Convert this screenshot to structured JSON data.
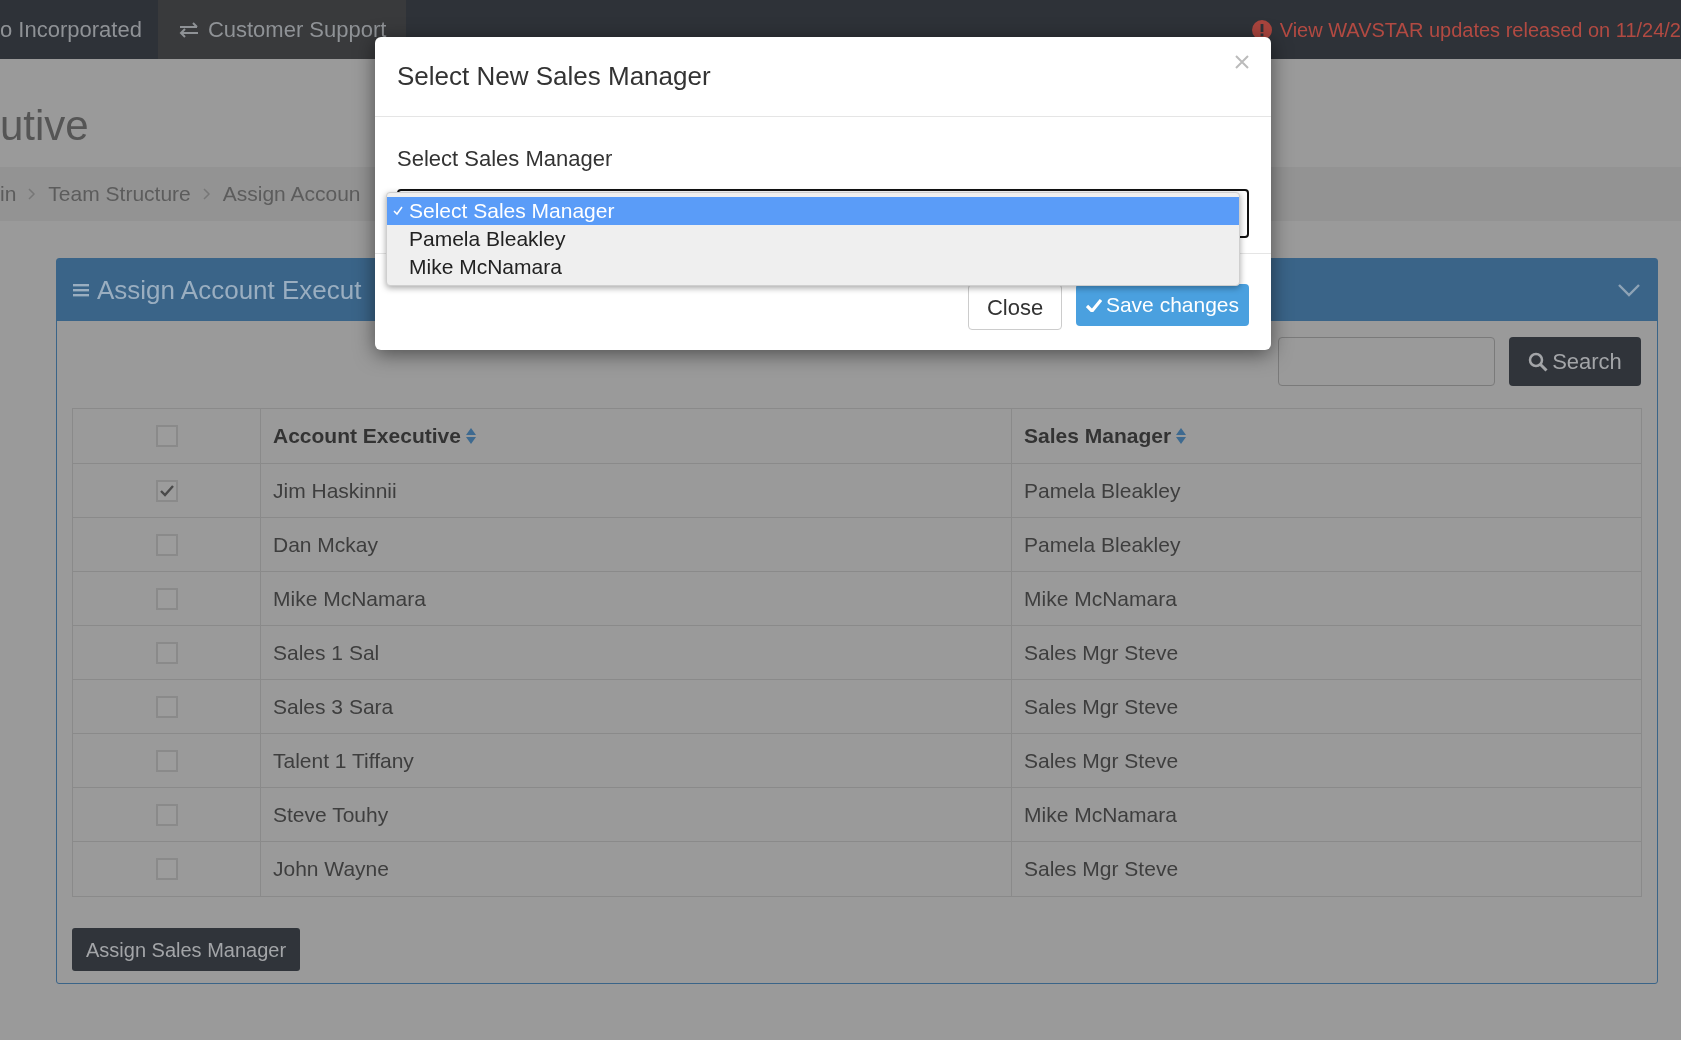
{
  "top_bar": {
    "company": "o Incorporated",
    "tab": "Customer Support",
    "alert": "View WAVSTAR updates released on 11/24/2"
  },
  "page_title": "utive",
  "breadcrumb": [
    "in",
    "Team Structure",
    "Assign Accoun"
  ],
  "panel": {
    "title": "Assign Account Execut",
    "search_button": "Search",
    "table": {
      "columns": [
        "Account Executive",
        "Sales Manager"
      ],
      "header_checked": false,
      "rows": [
        {
          "checked": true,
          "account_executive": "Jim Haskinnii",
          "sales_manager": "Pamela Bleakley"
        },
        {
          "checked": false,
          "account_executive": "Dan Mckay",
          "sales_manager": "Pamela Bleakley"
        },
        {
          "checked": false,
          "account_executive": "Mike McNamara",
          "sales_manager": "Mike McNamara"
        },
        {
          "checked": false,
          "account_executive": "Sales 1 Sal",
          "sales_manager": "Sales Mgr Steve"
        },
        {
          "checked": false,
          "account_executive": "Sales 3 Sara",
          "sales_manager": "Sales Mgr Steve"
        },
        {
          "checked": false,
          "account_executive": "Talent 1 Tiffany",
          "sales_manager": "Sales Mgr Steve"
        },
        {
          "checked": false,
          "account_executive": "Steve Touhy",
          "sales_manager": "Mike McNamara"
        },
        {
          "checked": false,
          "account_executive": "John Wayne",
          "sales_manager": "Sales Mgr Steve"
        }
      ]
    },
    "assign_button": "Assign Sales Manager"
  },
  "modal": {
    "title": "Select New Sales Manager",
    "label": "Select Sales Manager",
    "options": [
      {
        "label": "Select Sales Manager",
        "selected": true
      },
      {
        "label": "Pamela Bleakley",
        "selected": false
      },
      {
        "label": "Mike McNamara",
        "selected": false
      }
    ],
    "close_button": "Close",
    "save_button": "Save changes"
  }
}
